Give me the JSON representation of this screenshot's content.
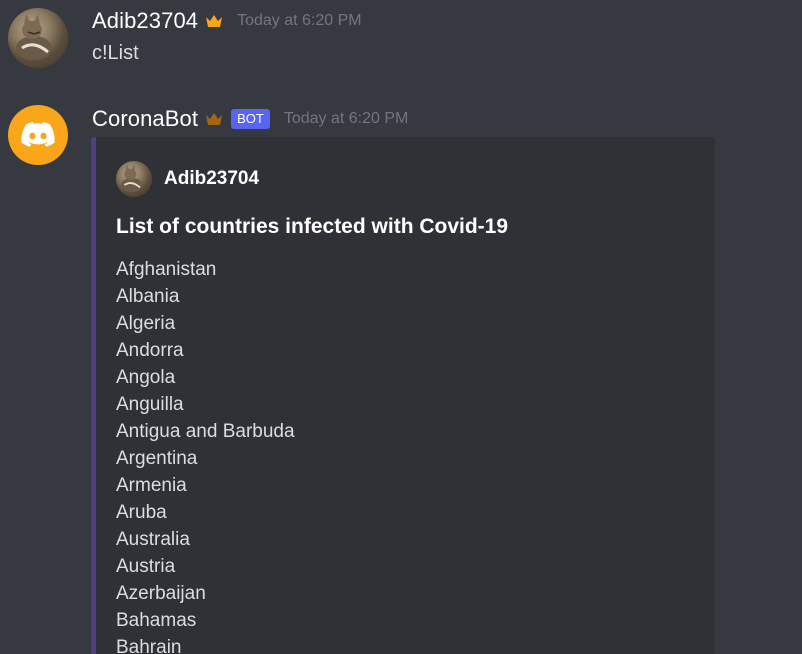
{
  "messages": [
    {
      "username": "Adib23704",
      "timestamp": "Today at 6:20 PM",
      "content": "c!List",
      "avatar_icon": "cat-avatar",
      "role_icon": "crown-icon"
    },
    {
      "username": "CoronaBot",
      "badge": "BOT",
      "timestamp": "Today at 6:20 PM",
      "avatar_icon": "discord-logo-icon",
      "role_icon": "crown-icon",
      "embed": {
        "author": "Adib23704",
        "title": "List of countries infected with Covid-19",
        "items": [
          "Afghanistan",
          "Albania",
          "Algeria",
          "Andorra",
          "Angola",
          "Anguilla",
          "Antigua and Barbuda",
          "Argentina",
          "Armenia",
          "Aruba",
          "Australia",
          "Austria",
          "Azerbaijan",
          "Bahamas",
          "Bahrain"
        ]
      }
    }
  ],
  "colors": {
    "background": "#36393f",
    "embed_background": "#2f3136",
    "embed_accent": "#4f3f7f",
    "bot_badge": "#5865f2",
    "crown": "#faa61a",
    "discord_avatar": "#faa61a"
  }
}
